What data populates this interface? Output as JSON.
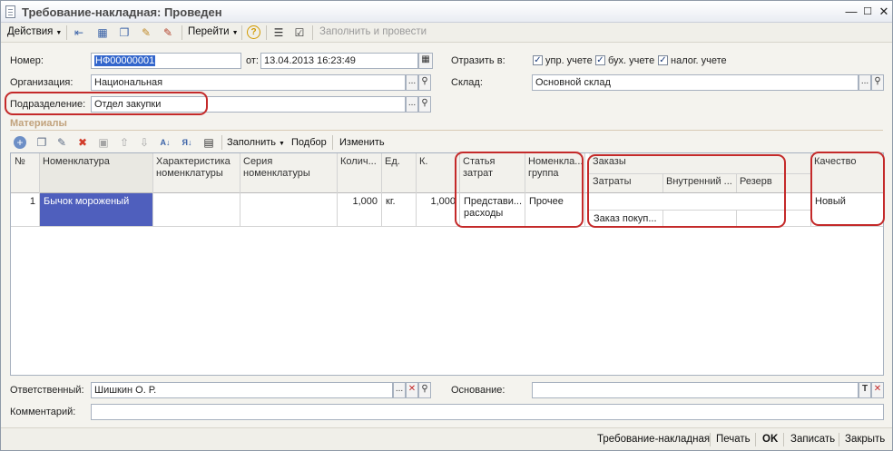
{
  "window": {
    "title": "Требование-накладная: Проведен"
  },
  "toolbar": {
    "actions_label": "Действия",
    "goto_label": "Перейти",
    "fill_and_post_label": "Заполнить и провести"
  },
  "form": {
    "number_label": "Номер:",
    "number_value": "НФ00000001",
    "date_label": "от:",
    "date_value": "13.04.2013 16:23:49",
    "org_label": "Организация:",
    "org_value": "Национальная",
    "dept_label": "Подразделение:",
    "dept_value": "Отдел закупки",
    "reflect_label": "Отразить в:",
    "reflect_mgmt": "упр. учете",
    "reflect_acc": "бух. учете",
    "reflect_tax": "налог. учете",
    "warehouse_label": "Склад:",
    "warehouse_value": "Основной склад"
  },
  "materials": {
    "section_title": "Материалы",
    "fill_label": "Заполнить",
    "pick_label": "Подбор",
    "edit_label": "Изменить"
  },
  "grid": {
    "headers": {
      "num": "№",
      "item": "Номенклатура",
      "characteristic": "Характеристика номенклатуры",
      "series": "Серия номенклатуры",
      "qty": "Колич...",
      "unit": "Ед.",
      "k": "К.",
      "cost_item": "Статья затрат",
      "item_group": "Номенкла... группа",
      "orders": "Заказы",
      "costs": "Затраты",
      "internal": "Внутренний ...",
      "reserve": "Резерв",
      "customer_order": "Заказ покуп...",
      "quality": "Качество"
    },
    "rows": [
      {
        "num": "1",
        "item": "Бычок мороженый",
        "characteristic": "",
        "series": "",
        "qty": "1,000",
        "unit": "кг.",
        "k": "1,000",
        "cost_item": "Представи... расходы",
        "item_group": "Прочее",
        "costs": "",
        "internal": "",
        "reserve": "",
        "customer_order": "",
        "quality": "Новый"
      }
    ]
  },
  "bottom": {
    "responsible_label": "Ответственный:",
    "responsible_value": "Шишкин О. Р.",
    "basis_label": "Основание:",
    "basis_value": "",
    "comment_label": "Комментарий:",
    "comment_value": ""
  },
  "footer": {
    "doc_label": "Требование-накладная",
    "print_label": "Печать",
    "ok_label": "OK",
    "save_label": "Записать",
    "close_label": "Закрыть"
  },
  "colors": {
    "highlight_red": "#c42a2a",
    "selected_blue": "#3366cc",
    "section_title": "#c1a27c"
  }
}
